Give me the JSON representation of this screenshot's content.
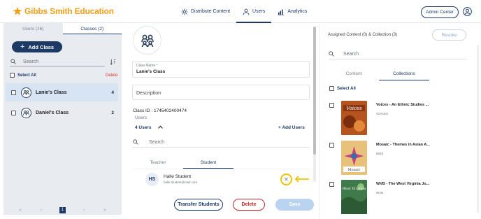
{
  "header": {
    "brand": "Gibbs Smith Education",
    "nav": [
      {
        "label": "Distribute Content",
        "icon": "distribute-icon"
      },
      {
        "label": "Users",
        "icon": "users-icon"
      },
      {
        "label": "Analytics",
        "icon": "analytics-icon"
      }
    ],
    "active_nav": "Users",
    "admin_center": "Admin Center"
  },
  "left": {
    "tabs": [
      "Users (16)",
      "Classes (2)"
    ],
    "active_tab": "Classes (2)",
    "add_class": "Add Class",
    "search_placeholder": "Search",
    "select_all": "Select All",
    "delete": "Delete",
    "classes": [
      {
        "name": "Lanie's Class",
        "count": "4",
        "selected": true
      },
      {
        "name": "Daniel's Class",
        "count": "2",
        "selected": false
      }
    ],
    "pagination": {
      "current": "1",
      "first": "«",
      "prev": "‹",
      "next": "›",
      "last": "»"
    }
  },
  "detail": {
    "class_name_label": "Class Name *",
    "class_name_value": "Lanie's Class",
    "description_placeholder": "Description",
    "class_id": "Class ID : 1745402400474",
    "users_label": "Users",
    "users_count": "4 Users",
    "add_users": "+ Add Users",
    "search_placeholder": "Search",
    "user_tabs": [
      "Teacher",
      "Student"
    ],
    "active_user_tab": "Student",
    "student": {
      "initials": "HS",
      "name": "Halle Student",
      "email": "halle.student@mail.com"
    },
    "buttons": {
      "transfer": "Transfer Students",
      "delete": "Delete",
      "save": "Save"
    }
  },
  "right": {
    "heading": "Assigned Content (0) & Collection (3)",
    "revoke": "Revoke",
    "search_placeholder": "Search",
    "tabs": [
      "Content",
      "Collections"
    ],
    "active_tab": "Collections",
    "select_all": "Select All",
    "collections": [
      {
        "title": "Voices - An Ethnic Studies ...",
        "sub": "VOICES",
        "cover_color": "#b5541f",
        "cover_text": "Voices"
      },
      {
        "title": "Mosaic - Themes in Asian A...",
        "sub": "MOS",
        "cover_color": "#d9a53e",
        "cover_text": "Mosaic"
      },
      {
        "title": "WVB - The West Virginia Jo...",
        "sub": "WVB",
        "cover_color": "#3f7a4a",
        "cover_text": "West Virginia"
      }
    ]
  },
  "colors": {
    "primary": "#1d3a64",
    "accent": "#f2a01c",
    "danger": "#c0282d",
    "highlight": "#f2c400"
  }
}
